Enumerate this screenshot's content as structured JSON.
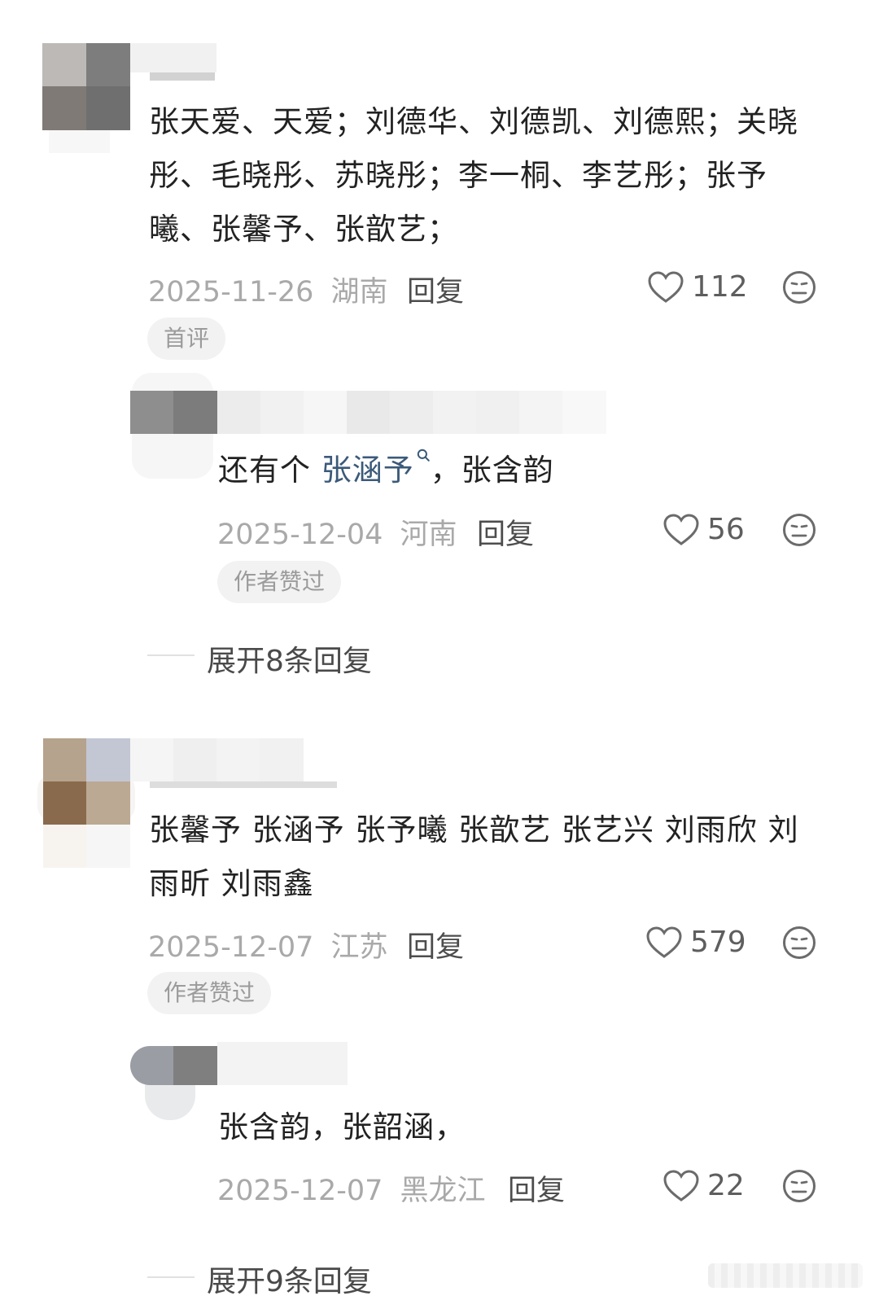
{
  "comments": [
    {
      "username": "",
      "text": "张天爱、天爱；刘德华、刘德凯、刘德熙；关晓彤、毛晓彤、苏晓彤；李一桐、李艺彤；张予曦、张馨予、张歆艺；",
      "date": "2025-11-26",
      "location": "湖南",
      "reply_label": "回复",
      "likes": "112",
      "tag": "首评",
      "reply": {
        "username": "",
        "text_prefix": "还有个 ",
        "mention": "张涵予",
        "text_suffix": "，张含韵",
        "date": "2025-12-04",
        "location": "河南",
        "reply_label": "回复",
        "likes": "56",
        "tag": "作者赞过"
      },
      "expand_label": "展开8条回复"
    },
    {
      "username": "",
      "text": "张馨予 张涵予 张予曦 张歆艺 张艺兴 刘雨欣 刘雨昕 刘雨鑫",
      "date": "2025-12-07",
      "location": "江苏",
      "reply_label": "回复",
      "likes": "579",
      "tag": "作者赞过",
      "reply": {
        "username": "",
        "text": "张含韵，张韶涵，",
        "date": "2025-12-07",
        "location": "黑龙江",
        "reply_label": "回复",
        "likes": "22"
      },
      "expand_label": "展开9条回复"
    }
  ],
  "icons": {
    "like": "heart-outline-icon",
    "dislike": "neutral-face-icon",
    "search_hint": "search-icon"
  },
  "colors": {
    "text": "#222222",
    "meta": "#a9a9a9",
    "mention": "#3b5a7a",
    "tag_bg": "#f2f2f2"
  }
}
